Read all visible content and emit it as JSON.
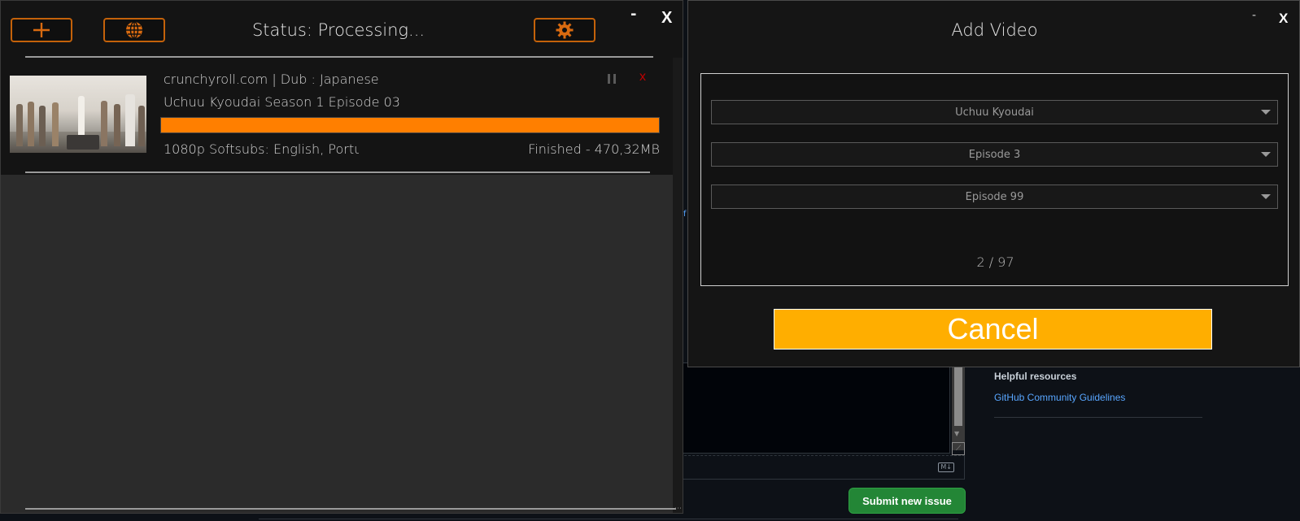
{
  "main_window": {
    "status_text": "Status: Processing...",
    "minimize_label": "-",
    "close_label": "X",
    "buttons": {
      "add_icon": "plus-icon",
      "globe_icon": "globe-icon",
      "settings_icon": "gear-icon"
    },
    "download": {
      "source_line": "crunchyroll.com | Dub : Japanese",
      "title": "Uchuu Kyoudai Season 1 Episode 03",
      "meta": "1080p  Softsubs: English, Portu",
      "status": "Finished - 470,32MB",
      "progress_percent": 100,
      "cancel_label": "x"
    },
    "colors": {
      "accent": "#ff7f00",
      "button_border": "#c4620a"
    }
  },
  "add_video_window": {
    "title": "Add Video",
    "minimize_label": "-",
    "close_label": "X",
    "series_select": "Uchuu Kyoudai",
    "start_episode_select": "Episode 3",
    "end_episode_select": "Episode 99",
    "counter": "2 / 97",
    "cancel_label": "Cancel",
    "colors": {
      "cancel_button": "#ffae00"
    }
  },
  "github_background": {
    "helpful_resources_title": "Helpful resources",
    "community_guidelines_link": "GitHub Community Guidelines",
    "submit_button": "Submit new issue",
    "markdown_badge": "M↓",
    "colors": {
      "submit": "#238636",
      "link": "#58a6ff"
    }
  }
}
